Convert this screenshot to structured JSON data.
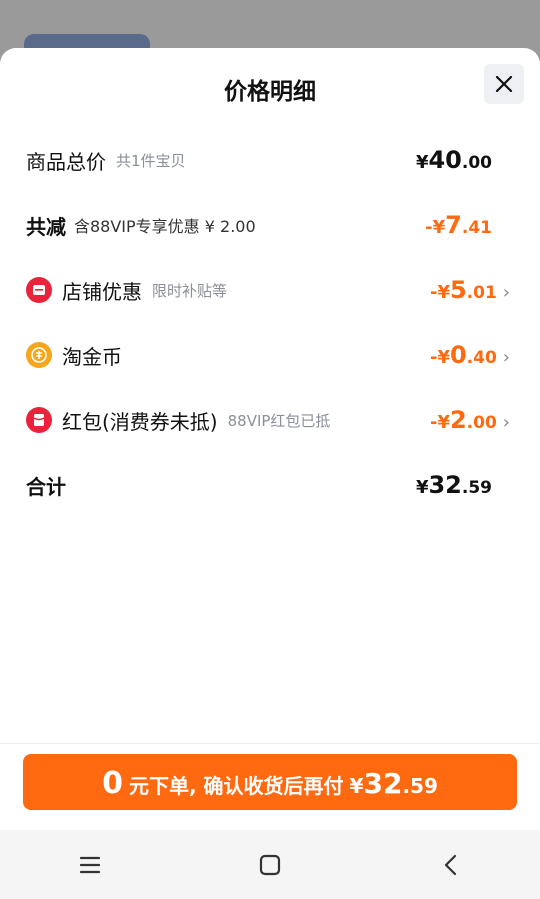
{
  "sheet": {
    "title": "价格明细",
    "close_label": "×"
  },
  "rows": [
    {
      "label": "商品总价",
      "sub": "共1件宝贝",
      "currency": "¥",
      "int": "40",
      "dec": ".00"
    },
    {
      "label": "共减",
      "sub": "含88VIP专享优惠 ¥ 2.00",
      "currency": "-¥",
      "int": "7",
      "dec": ".41"
    },
    {
      "label": "店铺优惠",
      "sub": "限时补贴等",
      "currency": "-¥",
      "int": "5",
      "dec": ".01",
      "icon": "store-icon"
    },
    {
      "label": "淘金币",
      "sub": "",
      "currency": "-¥",
      "int": "0",
      "dec": ".40",
      "icon": "coin-icon"
    },
    {
      "label": "红包(消费券未抵)",
      "sub": "88VIP红包已抵",
      "currency": "-¥",
      "int": "2",
      "dec": ".00",
      "icon": "red-packet-icon"
    },
    {
      "label": "合计",
      "sub": "",
      "currency": "¥",
      "int": "32",
      "dec": ".59"
    }
  ],
  "cta": {
    "lead_num": "0",
    "text": "元下单, 确认收货后再付",
    "currency": "¥",
    "int": "32",
    "dec": ".59"
  },
  "colors": {
    "accent": "#ff6a10",
    "icon_red": "#e8233b",
    "icon_gold": "#f7a51a"
  },
  "navbar": {
    "icons": [
      "menu-icon",
      "home-icon",
      "back-icon"
    ]
  }
}
